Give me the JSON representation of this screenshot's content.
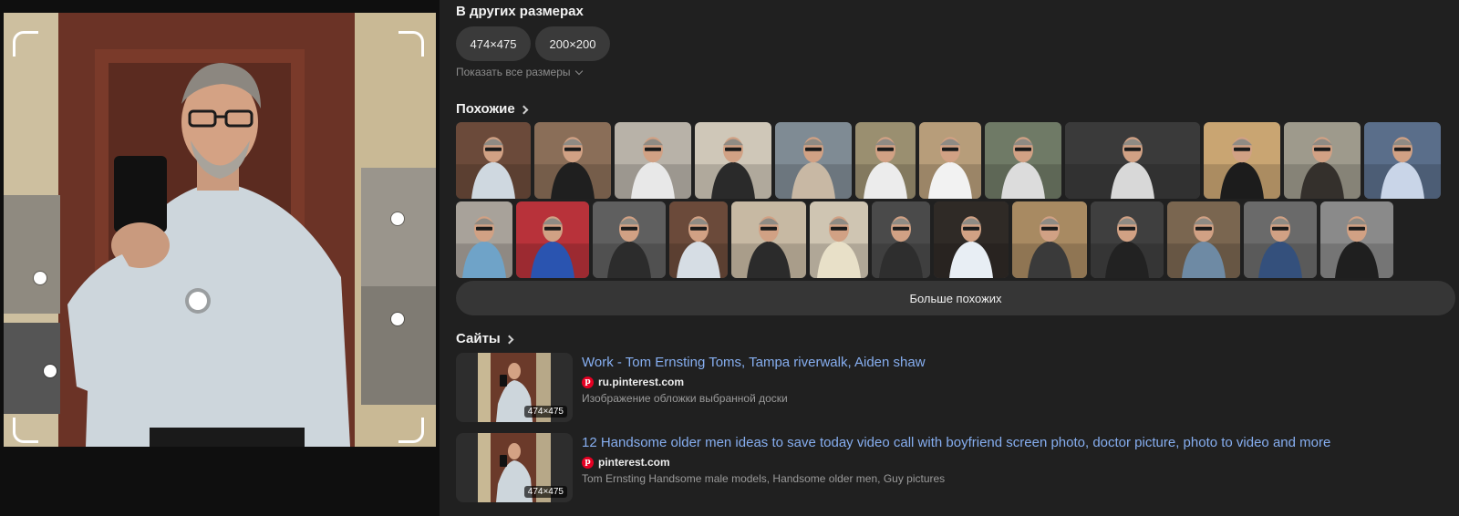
{
  "preview": {
    "alt": "main query image",
    "accent": "#ffffff"
  },
  "sizes": {
    "title": "В других размерах",
    "chips": [
      "474×475",
      "200×200"
    ],
    "show_all": "Показать все размеры"
  },
  "similar": {
    "title": "Похожие",
    "more_button": "Больше похожих",
    "row1": [
      {
        "bg": "#6b4a3a",
        "shirt": "#cfd8e0"
      },
      {
        "bg": "#8a6e58",
        "shirt": "#1f1f1f"
      },
      {
        "bg": "#b8b2a8",
        "shirt": "#e8e8e8"
      },
      {
        "bg": "#cfc7b8",
        "shirt": "#2a2a2a"
      },
      {
        "bg": "#7f8b94",
        "shirt": "#c8b8a4"
      },
      {
        "bg": "#9a8f70",
        "shirt": "#ececec"
      },
      {
        "bg": "#b79d7a",
        "shirt": "#f2f2f2"
      },
      {
        "bg": "#6f7a66",
        "shirt": "#dcdcdc"
      },
      {
        "bg": "#3a3a3a",
        "shirt": "#d8d8d8"
      },
      {
        "bg": "#c9a572",
        "shirt": "#1c1c1c"
      },
      {
        "bg": "#9e9a8c",
        "shirt": "#34302c"
      },
      {
        "bg": "#5a6e8a",
        "shirt": "#c9d5e8"
      }
    ],
    "row2": [
      {
        "bg": "#a8a29a",
        "shirt": "#6fa3c8"
      },
      {
        "bg": "#b8323a",
        "shirt": "#2a54b0"
      },
      {
        "bg": "#5f5f5f",
        "shirt": "#2c2c2c"
      },
      {
        "bg": "#6b4a3a",
        "shirt": "#d6dde4"
      },
      {
        "bg": "#c7b9a3",
        "shirt": "#2b2b2b"
      },
      {
        "bg": "#cfc5b2",
        "shirt": "#e8e0c8"
      },
      {
        "bg": "#4a4a4a",
        "shirt": "#2e2e2e"
      },
      {
        "bg": "#2f2a26",
        "shirt": "#e8eef4"
      },
      {
        "bg": "#a88a62",
        "shirt": "#3a3a3a"
      },
      {
        "bg": "#3f3f3f",
        "shirt": "#222222"
      },
      {
        "bg": "#7a6650",
        "shirt": "#6e8aa4"
      },
      {
        "bg": "#6a6a6a",
        "shirt": "#34507c"
      },
      {
        "bg": "#8a8a8a",
        "shirt": "#1f1f1f"
      }
    ]
  },
  "sites": {
    "title": "Сайты",
    "items": [
      {
        "title": "Work - Tom Ernsting Toms, Tampa riverwalk, Aiden shaw",
        "domain": "ru.pinterest.com",
        "desc": "Изображение обложки выбранной доски",
        "badge": "474×475"
      },
      {
        "title": "12 Handsome older men ideas to save today video call with boyfriend screen photo, doctor picture, photo to video and more",
        "domain": "pinterest.com",
        "desc": "Tom Ernsting Handsome male models, Handsome older men, Guy pictures",
        "badge": "474×475"
      }
    ]
  }
}
